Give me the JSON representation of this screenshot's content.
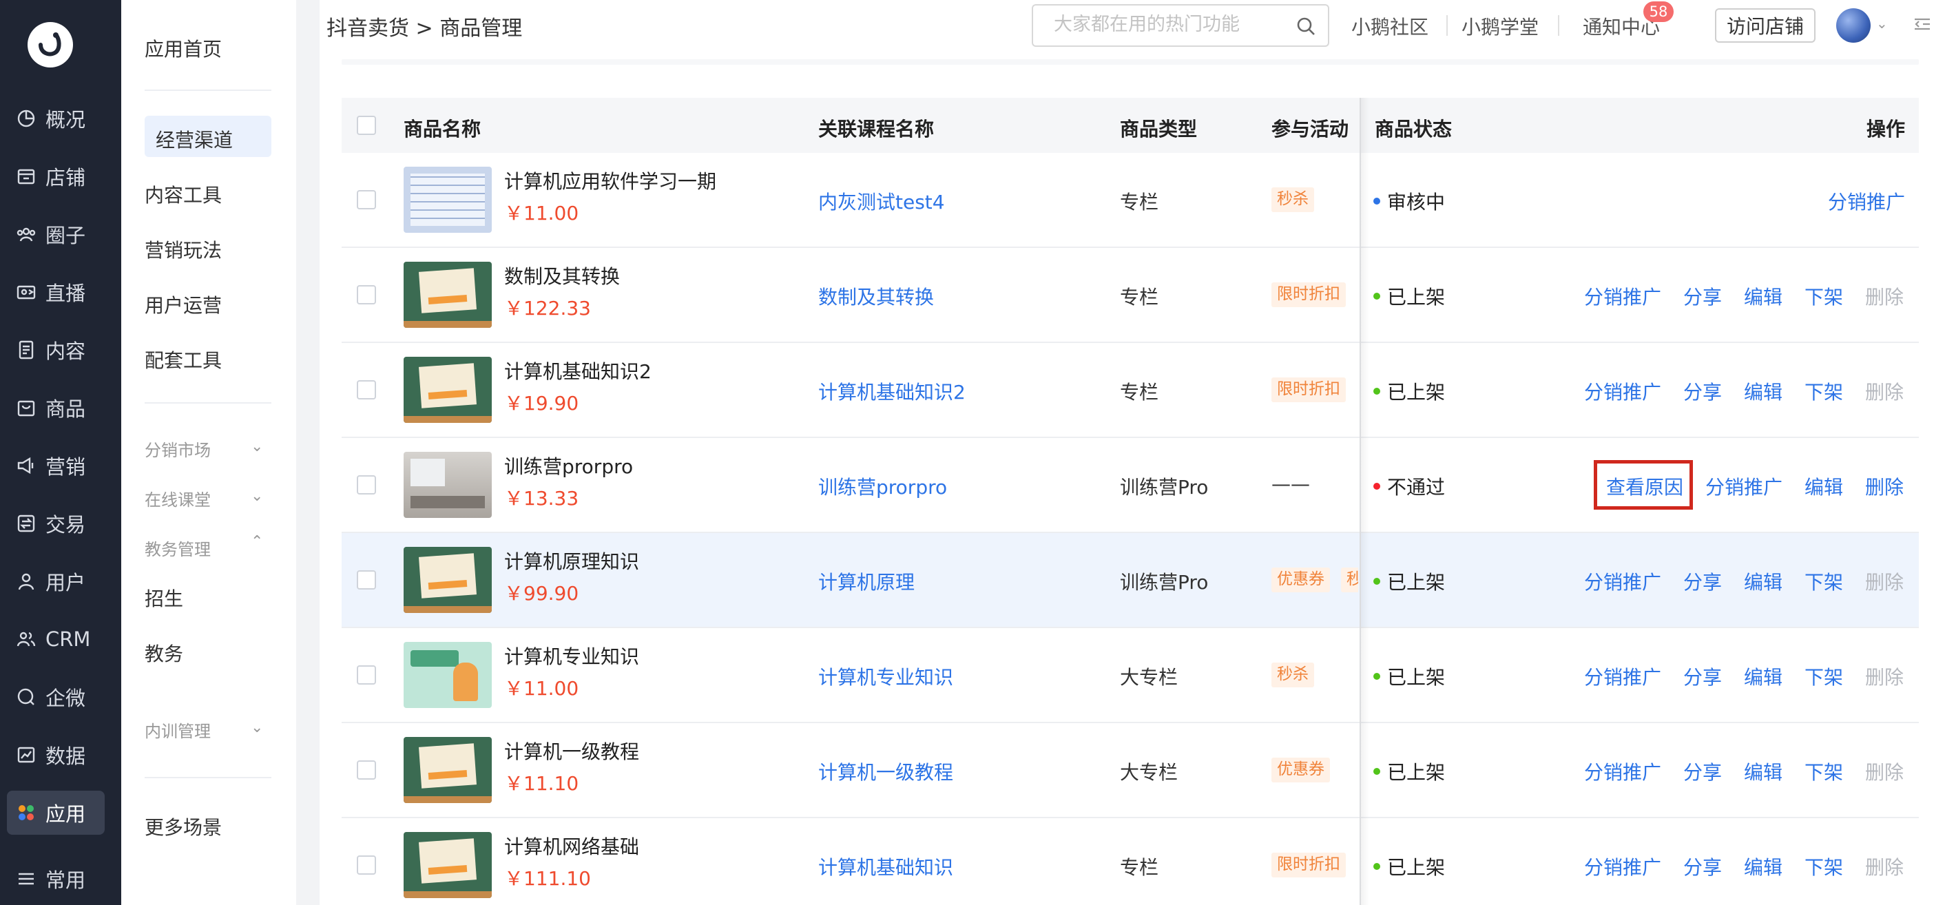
{
  "rail": {
    "items": [
      {
        "label": "概况",
        "icon": "pie-icon"
      },
      {
        "label": "店铺",
        "icon": "store-icon"
      },
      {
        "label": "圈子",
        "icon": "group-icon"
      },
      {
        "label": "直播",
        "icon": "live-icon"
      },
      {
        "label": "内容",
        "icon": "document-icon"
      },
      {
        "label": "商品",
        "icon": "bag-icon"
      },
      {
        "label": "营销",
        "icon": "megaphone-icon"
      },
      {
        "label": "交易",
        "icon": "exchange-icon"
      },
      {
        "label": "用户",
        "icon": "user-icon"
      },
      {
        "label": "CRM",
        "icon": "users-icon"
      },
      {
        "label": "企微",
        "icon": "wecom-icon"
      },
      {
        "label": "数据",
        "icon": "chart-icon"
      },
      {
        "label": "应用",
        "icon": "apps-icon"
      },
      {
        "label": "常用",
        "icon": "list-icon"
      }
    ]
  },
  "submenu": {
    "home": "应用首页",
    "items": [
      "经营渠道",
      "内容工具",
      "营销玩法",
      "用户运营",
      "配套工具"
    ],
    "groups": [
      "分销市场",
      "在线课堂",
      "教务管理"
    ],
    "edu_items": [
      "招生",
      "教务"
    ],
    "group_training": "内训管理",
    "more": "更多场景"
  },
  "header": {
    "breadcrumb": "抖音卖货 > 商品管理",
    "search_placeholder": "大家都在用的热门功能",
    "links": [
      "小鹅社区",
      "小鹅学堂",
      "通知中心"
    ],
    "notify_count": "58",
    "visit_store": "访问店铺"
  },
  "table": {
    "columns": {
      "name": "商品名称",
      "course": "关联课程名称",
      "type": "商品类型",
      "activity": "参与活动",
      "status": "商品状态",
      "ops": "操作"
    },
    "ops_labels": {
      "reason": "查看原因",
      "promote": "分销推广",
      "share": "分享",
      "edit": "编辑",
      "offshelf": "下架",
      "delete": "删除"
    },
    "rows": [
      {
        "name": "计算机应用软件学习一期",
        "price": "￥11.00",
        "course": "内灰测试test4",
        "type": "专栏",
        "activities": [
          "秒杀"
        ],
        "status": "审核中",
        "status_color": "#2d74e6"
      },
      {
        "name": "数制及其转换",
        "price": "￥122.33",
        "course": "数制及其转换",
        "type": "专栏",
        "activities": [
          "限时折扣"
        ],
        "status": "已上架",
        "status_color": "#52c41a"
      },
      {
        "name": "计算机基础知识2",
        "price": "￥19.90",
        "course": "计算机基础知识2",
        "type": "专栏",
        "activities": [
          "限时折扣"
        ],
        "status": "已上架",
        "status_color": "#52c41a"
      },
      {
        "name": "训练营prorpro",
        "price": "￥13.33",
        "course": "训练营prorpro",
        "type": "训练营Pro",
        "activities": [],
        "activity_text": "——",
        "status": "不通过",
        "status_color": "#f5222d"
      },
      {
        "name": "计算机原理知识",
        "price": "￥99.90",
        "course": "计算机原理",
        "type": "训练营Pro",
        "activities": [
          "优惠券",
          "秒杀"
        ],
        "status": "已上架",
        "status_color": "#52c41a"
      },
      {
        "name": "计算机专业知识",
        "price": "￥11.00",
        "course": "计算机专业知识",
        "type": "大专栏",
        "activities": [
          "秒杀"
        ],
        "status": "已上架",
        "status_color": "#52c41a"
      },
      {
        "name": "计算机一级教程",
        "price": "￥11.10",
        "course": "计算机一级教程",
        "type": "大专栏",
        "activities": [
          "优惠券"
        ],
        "status": "已上架",
        "status_color": "#52c41a"
      },
      {
        "name": "计算机网络基础",
        "price": "￥111.10",
        "course": "计算机基础知识",
        "type": "专栏",
        "activities": [
          "限时折扣"
        ],
        "status": "已上架",
        "status_color": "#52c41a"
      }
    ]
  }
}
